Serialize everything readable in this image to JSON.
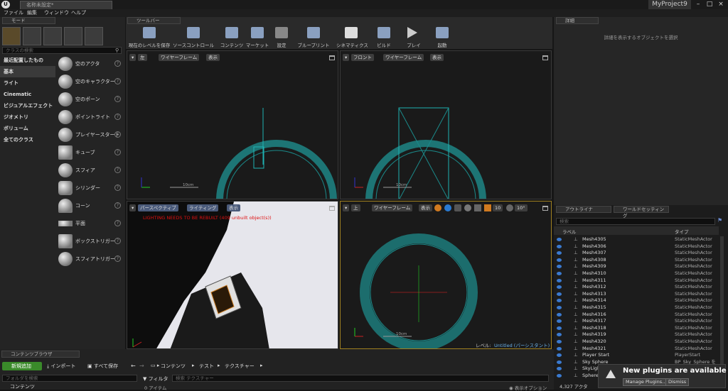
{
  "window": {
    "doc_tab": "名称未設定*",
    "project": "MyProject9",
    "min": "–",
    "max": "□",
    "close": "×"
  },
  "menu": [
    "ファイル",
    "編集",
    "ウィンドウ",
    "ヘルプ"
  ],
  "modes": {
    "tab": "モード",
    "search_placeholder": "クラスの検索",
    "categories": [
      "最近配置したもの",
      "基本",
      "ライト",
      "Cinematic",
      "ビジュアルエフェクト",
      "ジオメトリ",
      "ボリューム",
      "全てのクラス"
    ],
    "items": [
      "空のアクタ",
      "空のキャラクター",
      "空のポーン",
      "ポイントライト",
      "プレイヤースタート",
      "キューブ",
      "スフィア",
      "シリンダー",
      "コーン",
      "平面",
      "ボックストリガー",
      "スフィアトリガー"
    ]
  },
  "toolbar": {
    "tab": "ツールバー",
    "buttons": [
      "現在のレベルを保存",
      "ソースコントロール",
      "コンテンツ",
      "マーケット",
      "設定",
      "ブループリント",
      "シネマティクス",
      "ビルド",
      "プレイ",
      "起動"
    ]
  },
  "viewports": {
    "tl": {
      "view": "左",
      "mode": "ワイヤーフレーム",
      "show": "表示",
      "scale": "10cm"
    },
    "tr": {
      "view": "フロント",
      "mode": "ワイヤーフレーム",
      "show": "表示",
      "scale": "10cm"
    },
    "bl": {
      "view": "パースペクティブ",
      "mode": "ライティング",
      "show": "表示",
      "warning": "LIGHTING NEEDS TO BE REBUILT (409 unbuilt object(s))"
    },
    "br": {
      "view": "上",
      "mode": "ワイヤーフレーム",
      "show": "表示",
      "snap1": "10",
      "snap2": "10°",
      "scale": "10cm",
      "level_label": "レベル:",
      "level_name": "Untitled (パーシスタント)"
    }
  },
  "details": {
    "tab": "詳細",
    "empty_msg": "詳細を表示するオブジェクトを選択"
  },
  "outliner": {
    "tab1": "アウトライナ",
    "tab2": "ワールドセッティング",
    "search_placeholder": "検索",
    "col_label": "ラベル",
    "col_type": "タイプ",
    "rows": [
      {
        "name": "Mesh4305",
        "type": "StaticMeshActor"
      },
      {
        "name": "Mesh4306",
        "type": "StaticMeshActor"
      },
      {
        "name": "Mesh4307",
        "type": "StaticMeshActor"
      },
      {
        "name": "Mesh4308",
        "type": "StaticMeshActor"
      },
      {
        "name": "Mesh4309",
        "type": "StaticMeshActor"
      },
      {
        "name": "Mesh4310",
        "type": "StaticMeshActor"
      },
      {
        "name": "Mesh4311",
        "type": "StaticMeshActor"
      },
      {
        "name": "Mesh4312",
        "type": "StaticMeshActor"
      },
      {
        "name": "Mesh4313",
        "type": "StaticMeshActor"
      },
      {
        "name": "Mesh4314",
        "type": "StaticMeshActor"
      },
      {
        "name": "Mesh4315",
        "type": "StaticMeshActor"
      },
      {
        "name": "Mesh4316",
        "type": "StaticMeshActor"
      },
      {
        "name": "Mesh4317",
        "type": "StaticMeshActor"
      },
      {
        "name": "Mesh4318",
        "type": "StaticMeshActor"
      },
      {
        "name": "Mesh4319",
        "type": "StaticMeshActor"
      },
      {
        "name": "Mesh4320",
        "type": "StaticMeshActor"
      },
      {
        "name": "Mesh4321",
        "type": "StaticMeshActor"
      },
      {
        "name": "Player Start",
        "type": "PlayerStart"
      },
      {
        "name": "Sky Sphere",
        "type": "BP_Sky_Sphere を編"
      },
      {
        "name": "SkyLigh",
        "type": ""
      },
      {
        "name": "Sphere",
        "type": ""
      }
    ],
    "count": "4,327 アクタ"
  },
  "content_browser": {
    "tab": "コンテンツブラウザ",
    "add_new": "新規追加",
    "import": "インポート",
    "save_all": "すべて保存",
    "path": [
      "コンテンツ",
      "テスト",
      "テクスチャー"
    ],
    "folder_search": "フォルダを検索",
    "filter": "フィルタ",
    "asset_search": "検索 テクスチャー",
    "items_count": "0 アイテム",
    "view_options": "表示オプション",
    "tree_root": "コンテンツ"
  },
  "notification": {
    "title": "New plugins are available",
    "manage": "Manage Plugins...",
    "dismiss": "Dismiss"
  }
}
